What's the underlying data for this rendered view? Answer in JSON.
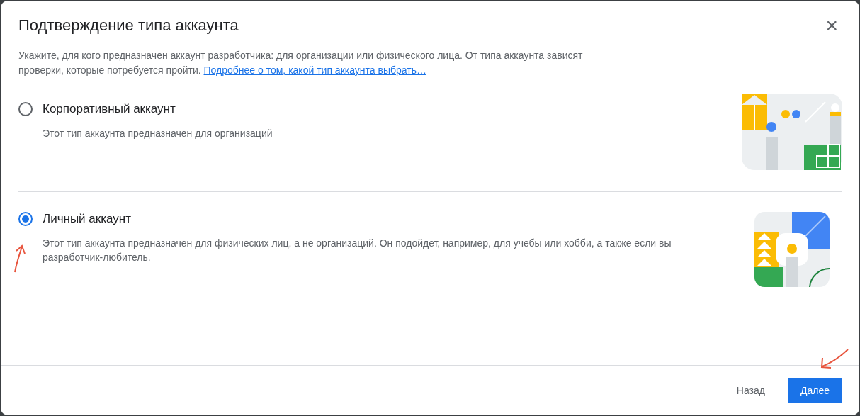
{
  "dialog": {
    "title": "Подтверждение типа аккаунта",
    "close": "×",
    "intro": "Укажите, для кого предназначен аккаунт разработчика: для организации или физического лица. От типа аккаунта зависят проверки, которые потребуется пройти.",
    "intro_link": "Подробнее о том, какой тип аккаунта выбрать…"
  },
  "options": [
    {
      "kind": "organization",
      "label": "Корпоративный аккаунт",
      "description": "Этот тип аккаунта предназначен для организаций",
      "selected": false
    },
    {
      "kind": "personal",
      "label": "Личный аккаунт",
      "description": "Этот тип аккаунта предназначен для физических лиц, а не организаций. Он подойдет, например, для учебы или хобби, а также если вы разработчик-любитель.",
      "selected": true
    }
  ],
  "footer": {
    "buttons": [
      {
        "label": "Назад",
        "kind": "text"
      },
      {
        "label": "Далее",
        "kind": "primary"
      }
    ]
  }
}
